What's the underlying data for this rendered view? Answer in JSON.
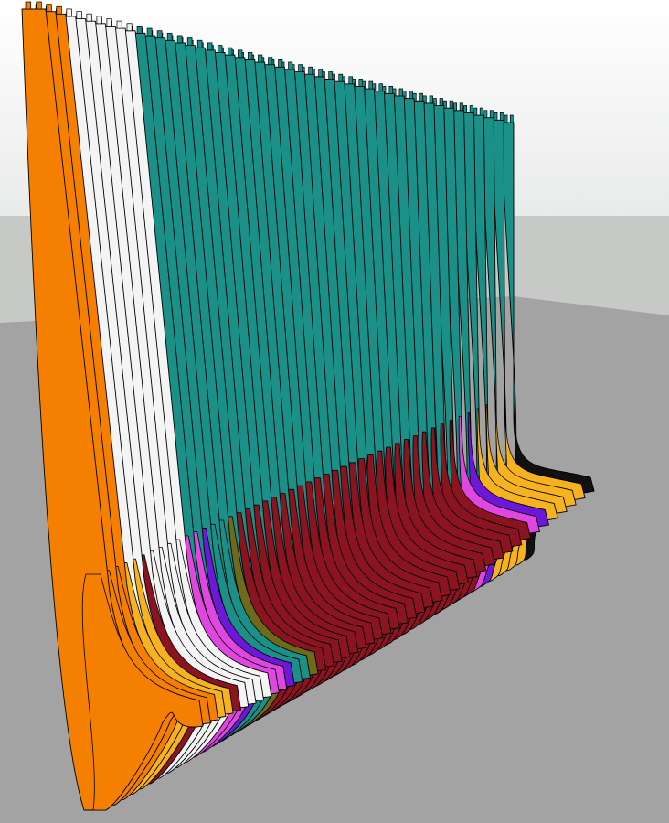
{
  "scene": {
    "subject": "parametric-slatted-bench",
    "colors": {
      "sky_top": "#ffffff",
      "sky_bottom": "#e9ebea",
      "horizon_band": "#c7c9c7",
      "ground": "#a3a3a3",
      "outline": "#000000",
      "orange": "#f57f00",
      "orange_dark": "#c75e00",
      "white": "#f4f4f4",
      "white_dark": "#bdbdbd",
      "teal": "#1a9089",
      "teal_dark": "#0e5f5b",
      "maroon": "#8a1520",
      "yellow": "#f6b31f",
      "magenta": "#e047e0",
      "purple": "#6d18d8",
      "olive": "#6d6a19",
      "black": "#111111"
    }
  }
}
